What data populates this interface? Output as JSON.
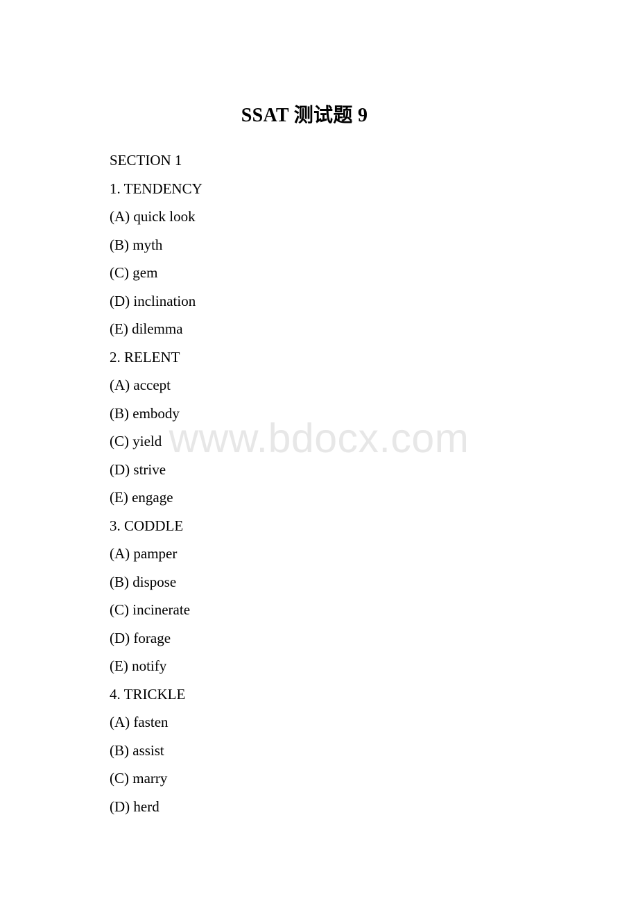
{
  "watermark": {
    "text": "www.bdocx.com"
  },
  "document": {
    "title": "SSAT 测试题 9",
    "title_latin": "SSAT",
    "title_cjk": "测试题",
    "title_number": "9",
    "section_label": "SECTION 1",
    "questions": [
      {
        "stem": "1. TENDENCY",
        "choices": [
          "(A) quick look",
          "(B) myth",
          "(C) gem",
          "(D) inclination",
          "(E) dilemma"
        ]
      },
      {
        "stem": "2. RELENT",
        "choices": [
          "(A) accept",
          "(B) embody",
          "(C) yield",
          "(D) strive",
          "(E) engage"
        ]
      },
      {
        "stem": "3. CODDLE",
        "choices": [
          "(A) pamper",
          "(B) dispose",
          "(C) incinerate",
          "(D) forage",
          "(E) notify"
        ]
      },
      {
        "stem": "4. TRICKLE",
        "choices": [
          "(A) fasten",
          "(B) assist",
          "(C) marry",
          "(D) herd"
        ]
      }
    ]
  }
}
